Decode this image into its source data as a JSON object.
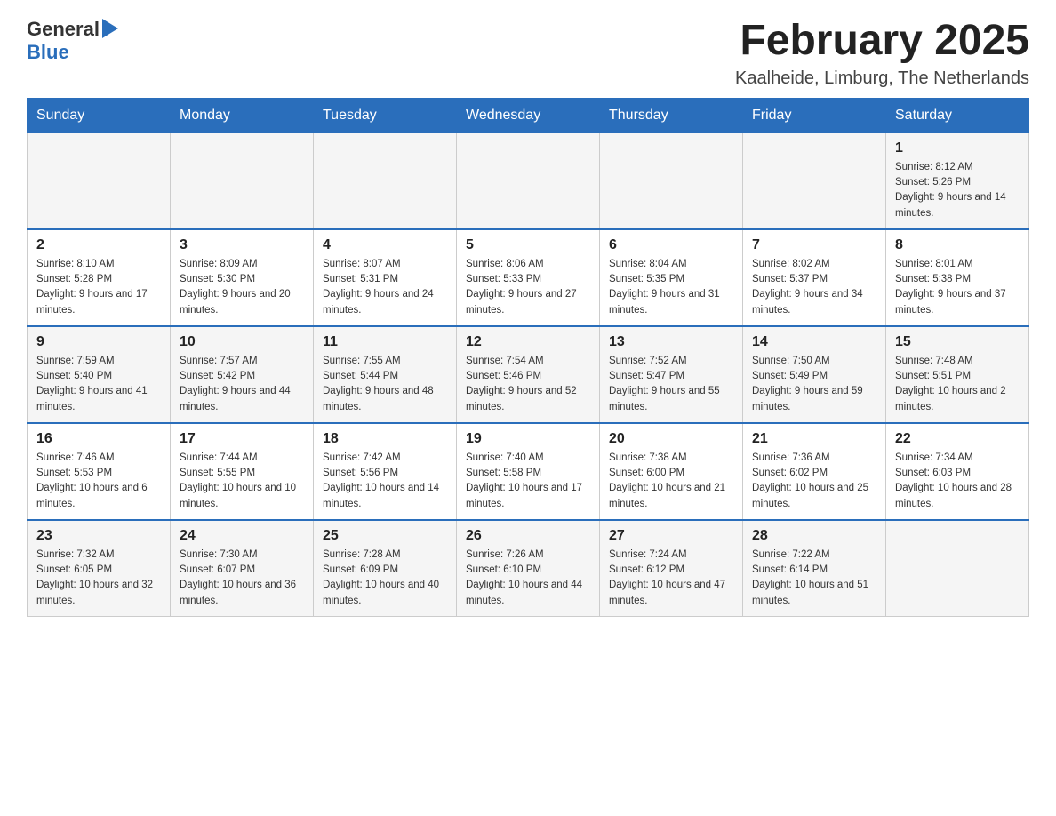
{
  "logo": {
    "general": "General",
    "blue": "Blue"
  },
  "title": "February 2025",
  "location": "Kaalheide, Limburg, The Netherlands",
  "weekdays": [
    "Sunday",
    "Monday",
    "Tuesday",
    "Wednesday",
    "Thursday",
    "Friday",
    "Saturday"
  ],
  "weeks": [
    [
      {
        "day": "",
        "sunrise": "",
        "sunset": "",
        "daylight": ""
      },
      {
        "day": "",
        "sunrise": "",
        "sunset": "",
        "daylight": ""
      },
      {
        "day": "",
        "sunrise": "",
        "sunset": "",
        "daylight": ""
      },
      {
        "day": "",
        "sunrise": "",
        "sunset": "",
        "daylight": ""
      },
      {
        "day": "",
        "sunrise": "",
        "sunset": "",
        "daylight": ""
      },
      {
        "day": "",
        "sunrise": "",
        "sunset": "",
        "daylight": ""
      },
      {
        "day": "1",
        "sunrise": "Sunrise: 8:12 AM",
        "sunset": "Sunset: 5:26 PM",
        "daylight": "Daylight: 9 hours and 14 minutes."
      }
    ],
    [
      {
        "day": "2",
        "sunrise": "Sunrise: 8:10 AM",
        "sunset": "Sunset: 5:28 PM",
        "daylight": "Daylight: 9 hours and 17 minutes."
      },
      {
        "day": "3",
        "sunrise": "Sunrise: 8:09 AM",
        "sunset": "Sunset: 5:30 PM",
        "daylight": "Daylight: 9 hours and 20 minutes."
      },
      {
        "day": "4",
        "sunrise": "Sunrise: 8:07 AM",
        "sunset": "Sunset: 5:31 PM",
        "daylight": "Daylight: 9 hours and 24 minutes."
      },
      {
        "day": "5",
        "sunrise": "Sunrise: 8:06 AM",
        "sunset": "Sunset: 5:33 PM",
        "daylight": "Daylight: 9 hours and 27 minutes."
      },
      {
        "day": "6",
        "sunrise": "Sunrise: 8:04 AM",
        "sunset": "Sunset: 5:35 PM",
        "daylight": "Daylight: 9 hours and 31 minutes."
      },
      {
        "day": "7",
        "sunrise": "Sunrise: 8:02 AM",
        "sunset": "Sunset: 5:37 PM",
        "daylight": "Daylight: 9 hours and 34 minutes."
      },
      {
        "day": "8",
        "sunrise": "Sunrise: 8:01 AM",
        "sunset": "Sunset: 5:38 PM",
        "daylight": "Daylight: 9 hours and 37 minutes."
      }
    ],
    [
      {
        "day": "9",
        "sunrise": "Sunrise: 7:59 AM",
        "sunset": "Sunset: 5:40 PM",
        "daylight": "Daylight: 9 hours and 41 minutes."
      },
      {
        "day": "10",
        "sunrise": "Sunrise: 7:57 AM",
        "sunset": "Sunset: 5:42 PM",
        "daylight": "Daylight: 9 hours and 44 minutes."
      },
      {
        "day": "11",
        "sunrise": "Sunrise: 7:55 AM",
        "sunset": "Sunset: 5:44 PM",
        "daylight": "Daylight: 9 hours and 48 minutes."
      },
      {
        "day": "12",
        "sunrise": "Sunrise: 7:54 AM",
        "sunset": "Sunset: 5:46 PM",
        "daylight": "Daylight: 9 hours and 52 minutes."
      },
      {
        "day": "13",
        "sunrise": "Sunrise: 7:52 AM",
        "sunset": "Sunset: 5:47 PM",
        "daylight": "Daylight: 9 hours and 55 minutes."
      },
      {
        "day": "14",
        "sunrise": "Sunrise: 7:50 AM",
        "sunset": "Sunset: 5:49 PM",
        "daylight": "Daylight: 9 hours and 59 minutes."
      },
      {
        "day": "15",
        "sunrise": "Sunrise: 7:48 AM",
        "sunset": "Sunset: 5:51 PM",
        "daylight": "Daylight: 10 hours and 2 minutes."
      }
    ],
    [
      {
        "day": "16",
        "sunrise": "Sunrise: 7:46 AM",
        "sunset": "Sunset: 5:53 PM",
        "daylight": "Daylight: 10 hours and 6 minutes."
      },
      {
        "day": "17",
        "sunrise": "Sunrise: 7:44 AM",
        "sunset": "Sunset: 5:55 PM",
        "daylight": "Daylight: 10 hours and 10 minutes."
      },
      {
        "day": "18",
        "sunrise": "Sunrise: 7:42 AM",
        "sunset": "Sunset: 5:56 PM",
        "daylight": "Daylight: 10 hours and 14 minutes."
      },
      {
        "day": "19",
        "sunrise": "Sunrise: 7:40 AM",
        "sunset": "Sunset: 5:58 PM",
        "daylight": "Daylight: 10 hours and 17 minutes."
      },
      {
        "day": "20",
        "sunrise": "Sunrise: 7:38 AM",
        "sunset": "Sunset: 6:00 PM",
        "daylight": "Daylight: 10 hours and 21 minutes."
      },
      {
        "day": "21",
        "sunrise": "Sunrise: 7:36 AM",
        "sunset": "Sunset: 6:02 PM",
        "daylight": "Daylight: 10 hours and 25 minutes."
      },
      {
        "day": "22",
        "sunrise": "Sunrise: 7:34 AM",
        "sunset": "Sunset: 6:03 PM",
        "daylight": "Daylight: 10 hours and 28 minutes."
      }
    ],
    [
      {
        "day": "23",
        "sunrise": "Sunrise: 7:32 AM",
        "sunset": "Sunset: 6:05 PM",
        "daylight": "Daylight: 10 hours and 32 minutes."
      },
      {
        "day": "24",
        "sunrise": "Sunrise: 7:30 AM",
        "sunset": "Sunset: 6:07 PM",
        "daylight": "Daylight: 10 hours and 36 minutes."
      },
      {
        "day": "25",
        "sunrise": "Sunrise: 7:28 AM",
        "sunset": "Sunset: 6:09 PM",
        "daylight": "Daylight: 10 hours and 40 minutes."
      },
      {
        "day": "26",
        "sunrise": "Sunrise: 7:26 AM",
        "sunset": "Sunset: 6:10 PM",
        "daylight": "Daylight: 10 hours and 44 minutes."
      },
      {
        "day": "27",
        "sunrise": "Sunrise: 7:24 AM",
        "sunset": "Sunset: 6:12 PM",
        "daylight": "Daylight: 10 hours and 47 minutes."
      },
      {
        "day": "28",
        "sunrise": "Sunrise: 7:22 AM",
        "sunset": "Sunset: 6:14 PM",
        "daylight": "Daylight: 10 hours and 51 minutes."
      },
      {
        "day": "",
        "sunrise": "",
        "sunset": "",
        "daylight": ""
      }
    ]
  ]
}
